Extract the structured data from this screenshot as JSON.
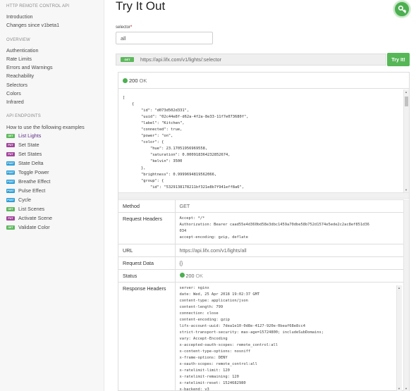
{
  "sidebar": {
    "api_title": "HTTP REMOTE CONTROL API",
    "top_links": [
      "Introduction",
      "Changes since v1beta1"
    ],
    "overview_title": "OVERVIEW",
    "overview_links": [
      "Authentication",
      "Rate Limits",
      "Errors and Warnings",
      "Reachability",
      "Selectors",
      "Colors",
      "Infrared"
    ],
    "endpoints_title": "API ENDPOINTS",
    "endpoints_intro": "How to use the following examples",
    "endpoints": [
      {
        "method": "GET",
        "label": "List Lights",
        "active": true
      },
      {
        "method": "PUT",
        "label": "Set State"
      },
      {
        "method": "PUT",
        "label": "Set States"
      },
      {
        "method": "POST",
        "label": "State Delta"
      },
      {
        "method": "POST",
        "label": "Toggle Power"
      },
      {
        "method": "POST",
        "label": "Breathe Effect"
      },
      {
        "method": "POST",
        "label": "Pulse Effect"
      },
      {
        "method": "POST",
        "label": "Cycle"
      },
      {
        "method": "GET",
        "label": "List Scenes"
      },
      {
        "method": "PUT",
        "label": "Activate Scene"
      },
      {
        "method": "GET",
        "label": "Validate Color"
      }
    ]
  },
  "main": {
    "title": "Try It Out",
    "selector_label": "selector",
    "selector_required": "*",
    "selector_value": "all",
    "method": "GET",
    "url": "https://api.lifx.com/v1/lights/:selector",
    "try_button": "Try It!",
    "status_code": "200",
    "status_text": "OK",
    "response_body": "[\n    {\n        \"id\": \"d073d502d331\",\n        \"uuid\": \"02c44e8f-d62a-4f2a-8e33-11f7e073680f\",\n        \"label\": \"Kitchen\",\n        \"connected\": true,\n        \"power\": \"on\",\n        \"color\": {\n            \"hue\": 23.17051956969558,\n            \"saturation\": 0.000918364232852674,\n            \"kelvin\": 3500\n        },\n        \"brightness\": 0.9999694819562066,\n        \"group\": {\n            \"id\": \"5329138178211bf321e8b7f941eff8a6\",",
    "details": {
      "method_label": "Method",
      "method_value": "GET",
      "req_headers_label": "Request Headers",
      "req_headers_value": "Accept: */*\nAuthorization: Bearer caad55e4d360bd58e3dbc1459a70dbe58b752d1574e5ede2c2ac8ef851d36\n034\naccept-encoding: gzip, deflate",
      "url_label": "URL",
      "url_value": "https://api.lifx.com/v1/lights/all",
      "req_data_label": "Request Data",
      "req_data_value": "{}",
      "status_label": "Status",
      "status_code": "200",
      "status_text": "OK",
      "resp_headers_label": "Response Headers",
      "resp_headers_value": "server: nginx\ndate: Wed, 25 Apr 2018 19:02:37 GMT\ncontent-type: application/json\ncontent-length: 799\nconnection: close\ncontent-encoding: gzip\nlifx-account-uuid: 7dea1e10-0d8e-4127-920e-0beaf68e8cc4\nstrict-transport-security: max-age=15724800; includeSubDomains;\nvary: Accept-Encoding\nx-accepted-oauth-scopes: remote_control:all\nx-content-type-options: nosniff\nx-frame-options: DENY\nx-oauth-scopes: remote_control:all\nx-ratelimit-limit: 120\nx-ratelimit-remaining: 120\nx-ratelimit-reset: 1524682980\nx-backend: v3"
    }
  },
  "icons": {
    "fab": "key-icon",
    "status": "status-dot-icon"
  },
  "colors": {
    "get": "#5db85c",
    "put": "#a1449b",
    "post": "#2e9fd6",
    "accent": "#4caf50",
    "active_link": "#5b2a86"
  }
}
